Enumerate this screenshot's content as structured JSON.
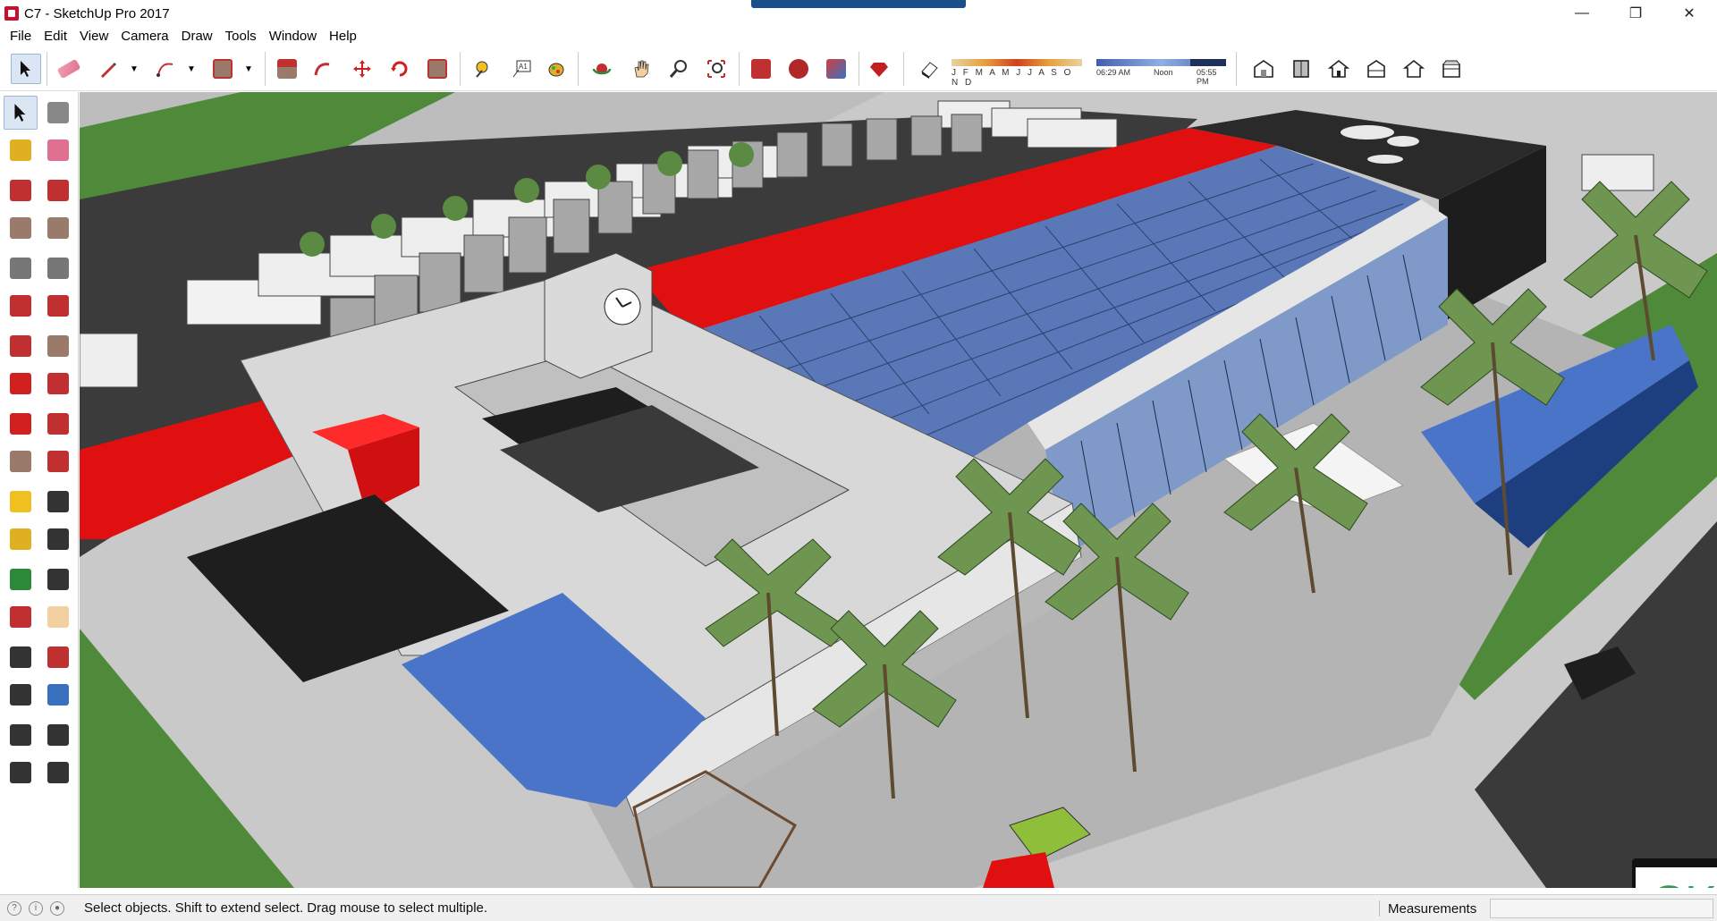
{
  "window": {
    "title": "C7 - SketchUp Pro 2017",
    "minimize_glyph": "—",
    "maximize_glyph": "❐",
    "close_glyph": "✕"
  },
  "menu": [
    "File",
    "Edit",
    "View",
    "Camera",
    "Draw",
    "Tools",
    "Window",
    "Help"
  ],
  "toolbar": {
    "icons": [
      "select-icon",
      "eraser-icon",
      "pencil-icon",
      "arc-icon",
      "rectangle-icon",
      "push-pull-icon",
      "follow-me-icon",
      "move-icon",
      "rotate-icon",
      "scale-icon",
      "tape-measure-icon",
      "text-icon",
      "paint-bucket-icon",
      "orbit-icon",
      "pan-icon",
      "zoom-icon",
      "zoom-extents-icon",
      "3d-warehouse-icon",
      "extension-warehouse-icon",
      "layout-icon",
      "ruby-icon",
      "shadows-toggle-icon",
      "iso-view-icon",
      "top-view-icon",
      "front-view-icon",
      "right-view-icon",
      "back-view-icon",
      "left-view-icon"
    ],
    "shadow_months": "J F M A M J J A S O N D",
    "shadow_time_start": "06:29 AM",
    "shadow_time_noon": "Noon",
    "shadow_time_end": "05:55 PM"
  },
  "left_toolbar": {
    "icons": [
      "select-icon",
      "make-component-icon",
      "paint-bucket-icon",
      "eraser-icon",
      "line-icon",
      "freehand-icon",
      "rectangle-icon",
      "rotated-rectangle-icon",
      "circle-icon",
      "polygon-icon",
      "arc-icon",
      "2pt-arc-icon",
      "3pt-arc-icon",
      "pie-icon",
      "move-icon",
      "push-pull-icon",
      "rotate-icon",
      "follow-me-icon",
      "scale-icon",
      "offset-icon",
      "tape-measure-icon",
      "dimension-icon",
      "protractor-icon",
      "text-icon",
      "axes-icon",
      "3d-text-icon",
      "orbit-icon",
      "pan-icon",
      "zoom-icon",
      "zoom-window-icon",
      "zoom-extents-icon",
      "previous-view-icon",
      "position-camera-icon",
      "look-around-icon",
      "walk-icon",
      "section-plane-icon"
    ]
  },
  "badge": {
    "text": "SKP"
  },
  "status": {
    "message": "Select objects. Shift to extend select. Drag mouse to select multiple.",
    "measurements_label": "Measurements",
    "measurements_value": ""
  },
  "colors": {
    "accent_red": "#e01010",
    "roof_gray": "#d8d8d8",
    "glass_blue": "#5a78b8",
    "grass_green": "#4f8a3a",
    "palm_green": "#6f9650",
    "skp_green": "#2f9a4d"
  }
}
